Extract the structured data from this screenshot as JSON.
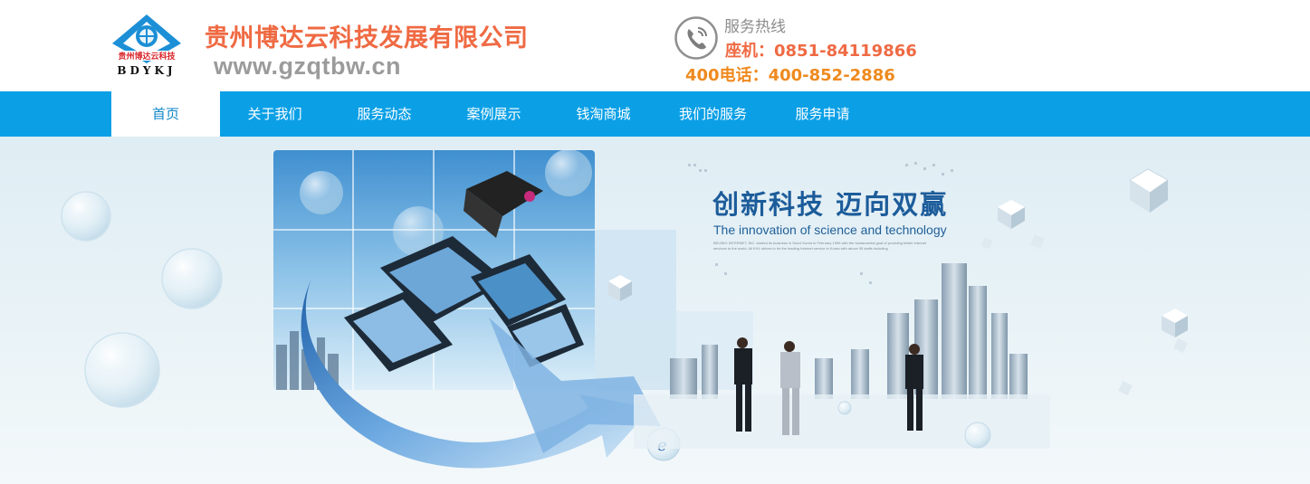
{
  "header": {
    "logo_text": "BDYKJ",
    "logo_seal_text": "贵州博达云科技",
    "company_name": "贵州博达云科技发展有限公司",
    "company_url": "www.gzqtbw.cn",
    "hotline_label": "服务热线",
    "phone_line1": "座机：0851-84119866",
    "phone_line2": "400电话：400-852-2886"
  },
  "nav": {
    "items": [
      {
        "label": "首页",
        "active": true
      },
      {
        "label": "关于我们"
      },
      {
        "label": "服务动态"
      },
      {
        "label": "案例展示"
      },
      {
        "label": "钱淘商城"
      },
      {
        "label": "我们的服务"
      },
      {
        "label": "服务申请"
      }
    ]
  },
  "banner": {
    "title": "创新科技  迈向双赢",
    "subtitle": "The innovation of science and technology",
    "fine_print": "BEIJING INTERNET, INC. started its business in Seoul Korea in February 1998 with the fundamental goal of providing better Internet services to the world. All KHL strives to be the leading Internet service in Korea with above 55 staffs including"
  },
  "colors": {
    "accent_orange": "#ef6a43",
    "phone_orange": "#ef8a1f",
    "nav_blue": "#0ba0e6",
    "active_text": "#0f86c7",
    "url_gray": "#9b9b9b",
    "banner_title": "#1c5c9a"
  },
  "icons": {
    "logo": "company-logo-icon",
    "hotline": "phone-icon"
  }
}
